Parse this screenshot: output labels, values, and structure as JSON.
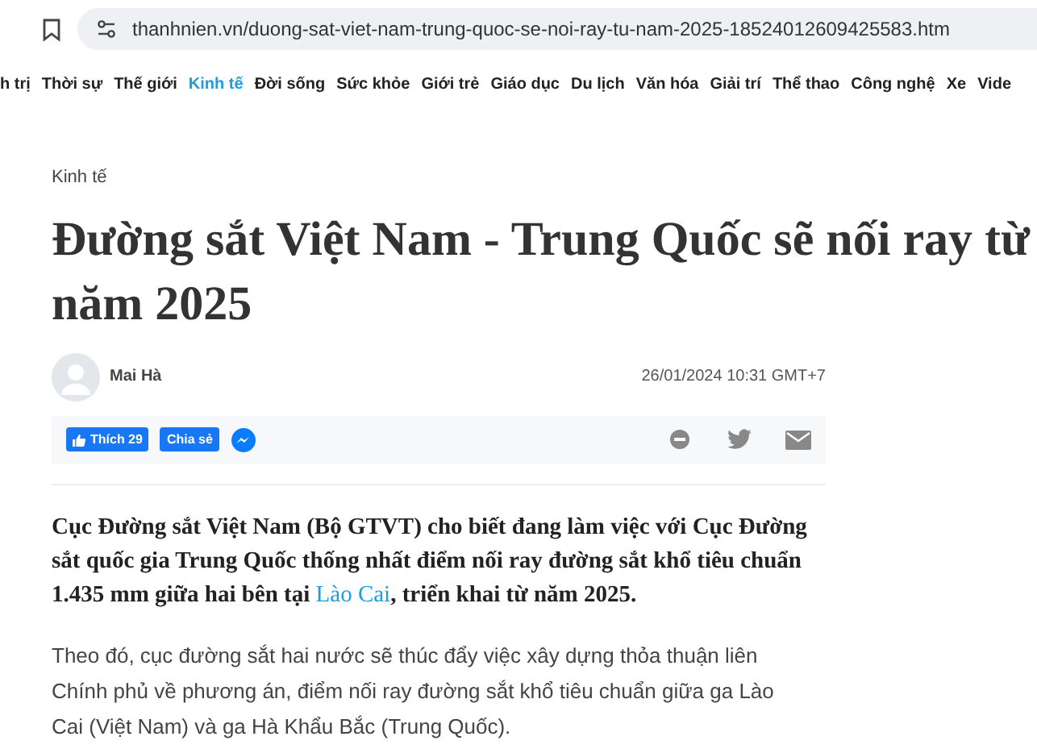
{
  "browser": {
    "url": "thanhnien.vn/duong-sat-viet-nam-trung-quoc-se-noi-ray-tu-nam-2025-18524012609425583.htm"
  },
  "nav": [
    {
      "label": "h trị",
      "selected": false
    },
    {
      "label": "Thời sự",
      "selected": false
    },
    {
      "label": "Thế giới",
      "selected": false
    },
    {
      "label": "Kinh tế",
      "selected": true
    },
    {
      "label": "Đời sống",
      "selected": false
    },
    {
      "label": "Sức khỏe",
      "selected": false
    },
    {
      "label": "Giới trẻ",
      "selected": false
    },
    {
      "label": "Giáo dục",
      "selected": false
    },
    {
      "label": "Du lịch",
      "selected": false
    },
    {
      "label": "Văn hóa",
      "selected": false
    },
    {
      "label": "Giải trí",
      "selected": false
    },
    {
      "label": "Thể thao",
      "selected": false
    },
    {
      "label": "Công nghệ",
      "selected": false
    },
    {
      "label": "Xe",
      "selected": false
    },
    {
      "label": "Vide",
      "selected": false
    }
  ],
  "article": {
    "category": "Kinh tế",
    "title": "Đường sắt Việt Nam - Trung Quốc sẽ nối ray từ năm 2025",
    "author": "Mai Hà",
    "date": "26/01/2024 10:31 GMT+7",
    "like_button": "Thích 29",
    "share_button": "Chia sẻ",
    "lead": {
      "before": "Cục Đường sắt Việt Nam (Bộ GTVT) cho biết đang làm việc với Cục Đường sắt quốc gia Trung Quốc thống nhất điểm nối ray đường sắt khổ tiêu chuẩn 1.435 mm giữa hai bên tại ",
      "link": "Lào Cai",
      "after": ", triển khai từ năm 2025."
    },
    "paragraphs": [
      "Theo đó, cục đường sắt hai nước sẽ thúc đẩy việc xây dựng thỏa thuận liên Chính phủ về phương án, điểm nối ray đường sắt khổ tiêu chuẩn giữa ga Lào Cai (Việt Nam) và ga Hà Khẩu Bắc (Trung Quốc)."
    ]
  }
}
